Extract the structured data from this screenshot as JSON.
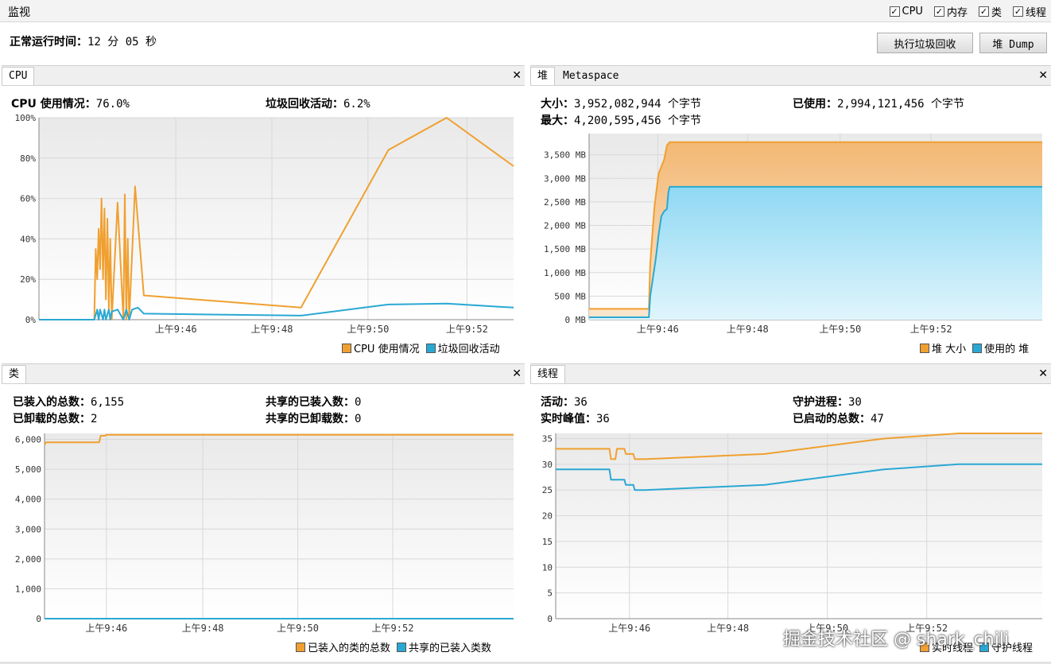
{
  "header": {
    "title": "监视",
    "checkboxes": [
      {
        "label": "CPU",
        "checked": true
      },
      {
        "label": "内存",
        "checked": true
      },
      {
        "label": "类",
        "checked": true
      },
      {
        "label": "线程",
        "checked": true
      }
    ],
    "uptime_label": "正常运行时间：",
    "uptime_value": "12 分 05 秒",
    "gc_button": "执行垃圾回收",
    "dump_button": "堆 Dump"
  },
  "colors": {
    "orange": "#f0a030",
    "blue": "#2aa8d4",
    "orange_fill": "#f7c896",
    "blue_fill": "#aee4f6"
  },
  "cpu": {
    "tab": "CPU",
    "usage_label": "CPU 使用情况：",
    "usage_value": "76.0%",
    "gc_label": "垃圾回收活动：",
    "gc_value": "6.2%",
    "legend": [
      "CPU 使用情况",
      "垃圾回收活动"
    ],
    "chart_data": {
      "type": "line",
      "xlim": [
        9.72,
        9.883
      ],
      "ylim": [
        0,
        100
      ],
      "y_ticks": [
        0,
        20,
        40,
        60,
        80,
        100
      ],
      "y_tick_labels": [
        "0%",
        "20%",
        "40%",
        "60%",
        "80%",
        "100%"
      ],
      "x_ticks": [
        9.767,
        9.8,
        9.833,
        9.867
      ],
      "x_tick_labels": [
        "上午9:46",
        "上午9:48",
        "上午9:50",
        "上午9:52"
      ],
      "series": [
        {
          "name": "CPU 使用情况",
          "x": [
            9.72,
            9.739,
            9.7395,
            9.74,
            9.7405,
            9.741,
            9.7415,
            9.742,
            9.7425,
            9.743,
            9.7435,
            9.744,
            9.7445,
            9.745,
            9.747,
            9.749,
            9.7495,
            9.75,
            9.7505,
            9.751,
            9.753,
            9.756,
            9.81,
            9.84,
            9.86,
            9.883
          ],
          "y": [
            0,
            0,
            35,
            20,
            45,
            25,
            60,
            20,
            55,
            10,
            50,
            5,
            40,
            0,
            58,
            0,
            62,
            0,
            40,
            0,
            66,
            12,
            6,
            84,
            100,
            76
          ]
        },
        {
          "name": "垃圾回收活动",
          "x": [
            9.72,
            9.739,
            9.74,
            9.7405,
            9.741,
            9.742,
            9.7425,
            9.743,
            9.744,
            9.7445,
            9.745,
            9.747,
            9.749,
            9.75,
            9.751,
            9.752,
            9.754,
            9.756,
            9.81,
            9.84,
            9.86,
            9.883
          ],
          "y": [
            0,
            0,
            5,
            0,
            5,
            0,
            5,
            0,
            5,
            0,
            4,
            5,
            0,
            5,
            0,
            5,
            6,
            3,
            2,
            7.5,
            8,
            6
          ]
        }
      ]
    }
  },
  "memory": {
    "tabs": [
      "堆",
      "Metaspace"
    ],
    "size_label": "大小：",
    "size_value": "3,952,082,944 个字节",
    "max_label": "最大：",
    "max_value": "4,200,595,456 个字节",
    "used_label": "已使用：",
    "used_value": "2,994,121,456 个字节",
    "legend": [
      "堆 大小",
      "使用的 堆"
    ],
    "chart_data": {
      "type": "area",
      "xlim": [
        9.72,
        9.883
      ],
      "ylim": [
        0,
        3950
      ],
      "y_ticks": [
        0,
        500,
        1000,
        1500,
        2000,
        2500,
        3000,
        3500
      ],
      "y_tick_labels": [
        "0 MB",
        "500 MB",
        "1,000 MB",
        "1,500 MB",
        "2,000 MB",
        "2,500 MB",
        "3,000 MB",
        "3,500 MB"
      ],
      "x_ticks": [
        9.7447,
        9.777,
        9.8103,
        9.843
      ],
      "x_tick_labels": [
        "上午9:46",
        "上午9:48",
        "上午9:50",
        "上午9:52"
      ],
      "series": [
        {
          "name": "堆 大小",
          "x": [
            9.72,
            9.7415,
            9.742,
            9.743,
            9.7435,
            9.745,
            9.747,
            9.748,
            9.749,
            9.883
          ],
          "y": [
            230,
            230,
            1200,
            2000,
            2400,
            3100,
            3400,
            3700,
            3770,
            3770
          ]
        },
        {
          "name": "使用的 堆",
          "x": [
            9.72,
            9.7415,
            9.742,
            9.743,
            9.744,
            9.745,
            9.746,
            9.747,
            9.748,
            9.7485,
            9.749,
            9.883
          ],
          "y": [
            50,
            50,
            500,
            900,
            1300,
            1800,
            2200,
            2300,
            2350,
            2700,
            2820,
            2820
          ]
        }
      ]
    }
  },
  "classes": {
    "tab": "类",
    "loaded_label": "已装入的总数：",
    "loaded_value": "6,155",
    "unloaded_label": "已卸载的总数：",
    "unloaded_value": "2",
    "shared_loaded_label": "共享的已装入数：",
    "shared_loaded_value": "0",
    "shared_unloaded_label": "共享的已卸载数：",
    "shared_unloaded_value": "0",
    "legend": [
      "已装入的类的总数",
      "共享的已装入类数"
    ],
    "chart_data": {
      "type": "line",
      "xlim": [
        9.72,
        9.883
      ],
      "ylim": [
        0,
        6200
      ],
      "y_ticks": [
        0,
        1000,
        2000,
        3000,
        4000,
        5000,
        6000
      ],
      "y_tick_labels": [
        "0",
        "1,000",
        "2,000",
        "3,000",
        "4,000",
        "5,000",
        "6,000"
      ],
      "x_ticks": [
        9.7415,
        9.775,
        9.808,
        9.841
      ],
      "x_tick_labels": [
        "上午9:46",
        "上午9:48",
        "上午9:50",
        "上午9:52"
      ],
      "series": [
        {
          "name": "已装入的类的总数",
          "x": [
            9.72,
            9.7205,
            9.739,
            9.7395,
            9.741,
            9.7415,
            9.883
          ],
          "y": [
            5820,
            5900,
            5900,
            6120,
            6120,
            6155,
            6155
          ]
        },
        {
          "name": "共享的已装入类数",
          "x": [
            9.72,
            9.883
          ],
          "y": [
            0,
            0
          ]
        }
      ]
    }
  },
  "threads": {
    "tab": "线程",
    "live_label": "活动：",
    "live_value": "36",
    "peak_label": "实时峰值：",
    "peak_value": "36",
    "daemon_label": "守护进程：",
    "daemon_value": "30",
    "started_label": "已启动的总数：",
    "started_value": "47",
    "legend": [
      "实时线程",
      "守护线程"
    ],
    "chart_data": {
      "type": "line",
      "xlim": [
        9.72,
        9.883
      ],
      "ylim": [
        0,
        36
      ],
      "y_ticks": [
        0,
        5,
        10,
        15,
        20,
        25,
        30,
        35
      ],
      "y_tick_labels": [
        "0",
        "5",
        "10",
        "15",
        "20",
        "25",
        "30",
        "35"
      ],
      "x_ticks": [
        9.7447,
        9.7777,
        9.811,
        9.8443
      ],
      "x_tick_labels": [
        "上午9:46",
        "上午9:48",
        "上午9:50",
        "上午9:52"
      ],
      "series": [
        {
          "name": "实时线程",
          "x": [
            9.72,
            9.738,
            9.7385,
            9.74,
            9.7405,
            9.743,
            9.7435,
            9.746,
            9.7465,
            9.75,
            9.79,
            9.83,
            9.855,
            9.883
          ],
          "y": [
            33,
            33,
            31,
            31,
            33,
            33,
            32,
            32,
            31,
            31,
            32,
            35,
            36,
            36
          ]
        },
        {
          "name": "守护线程",
          "x": [
            9.72,
            9.738,
            9.7385,
            9.743,
            9.7435,
            9.746,
            9.7465,
            9.75,
            9.79,
            9.83,
            9.855,
            9.883
          ],
          "y": [
            29,
            29,
            27,
            27,
            26,
            26,
            25,
            25,
            26,
            29,
            30,
            30
          ]
        }
      ]
    }
  },
  "watermark": "掘金技术社区 @ shark_chili"
}
